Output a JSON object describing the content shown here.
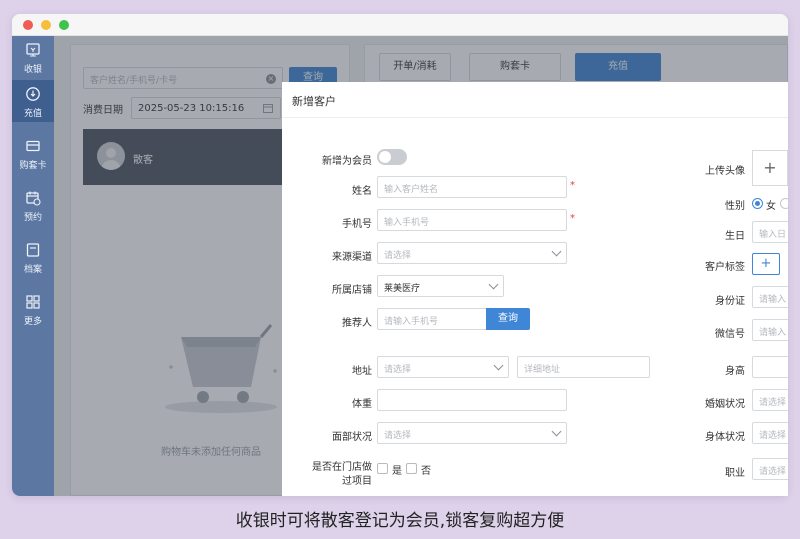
{
  "sidebar": {
    "items": [
      {
        "label": "收银",
        "icon": "cashier-icon",
        "active": false
      },
      {
        "label": "充值",
        "icon": "recharge-icon",
        "active": true
      },
      {
        "label": "购套卡",
        "icon": "card-icon",
        "active": false
      },
      {
        "label": "预约",
        "icon": "calendar-clock-icon",
        "active": false
      },
      {
        "label": "档案",
        "icon": "archive-icon",
        "active": false
      },
      {
        "label": "更多",
        "icon": "grid-icon",
        "active": false
      }
    ]
  },
  "left_panel": {
    "search_placeholder": "客户姓名/手机号/卡号",
    "query_label": "查询",
    "date_label": "消费日期",
    "date_value": "2025-05-23 10:15:16",
    "customer_name": "散客",
    "empty_text": "购物车未添加任何商品"
  },
  "tabs": [
    {
      "label": "开单/消耗",
      "primary": false
    },
    {
      "label": "购套卡",
      "primary": false
    },
    {
      "label": "充值",
      "primary": true
    }
  ],
  "dialog": {
    "title": "新增客户",
    "left_fields": {
      "member_label": "新增为会员",
      "name_label": "姓名",
      "name_placeholder": "输入客户姓名",
      "phone_label": "手机号",
      "phone_placeholder": "输入手机号",
      "source_label": "来源渠道",
      "source_placeholder": "请选择",
      "store_label": "所属店铺",
      "store_value": "莱美医疗",
      "referrer_label": "推荐人",
      "referrer_placeholder": "请输入手机号",
      "referrer_button": "查询",
      "address_label": "地址",
      "address_placeholder": "请选择",
      "address_detail_placeholder": "详细地址",
      "weight_label": "体重",
      "face_label": "面部状况",
      "face_placeholder": "请选择",
      "project_label_line1": "是否在门店做",
      "project_label_line2": "过项目",
      "yes_label": "是",
      "no_label": "否"
    },
    "right_fields": {
      "avatar_label": "上传头像",
      "upload_symbol": "+",
      "gender_label": "性别",
      "gender_female": "女",
      "birthday_label": "生日",
      "birthday_placeholder": "输入日",
      "tags_label": "客户标签",
      "tags_add_symbol": "+",
      "id_label": "身份证",
      "id_placeholder": "请输入",
      "wechat_label": "微信号",
      "wechat_placeholder": "请输入",
      "height_label": "身高",
      "marital_label": "婚姻状况",
      "marital_placeholder": "请选择",
      "body_label": "身体状况",
      "body_placeholder": "请选择",
      "job_label": "职业",
      "job_placeholder": "请选择"
    }
  },
  "caption": "收银时可将散客登记为会员,锁客复购超方便",
  "colors": {
    "background": "#ded2ea",
    "sidebar": "#5b77a2",
    "primary": "#3f86d6",
    "required": "#e0443c"
  }
}
